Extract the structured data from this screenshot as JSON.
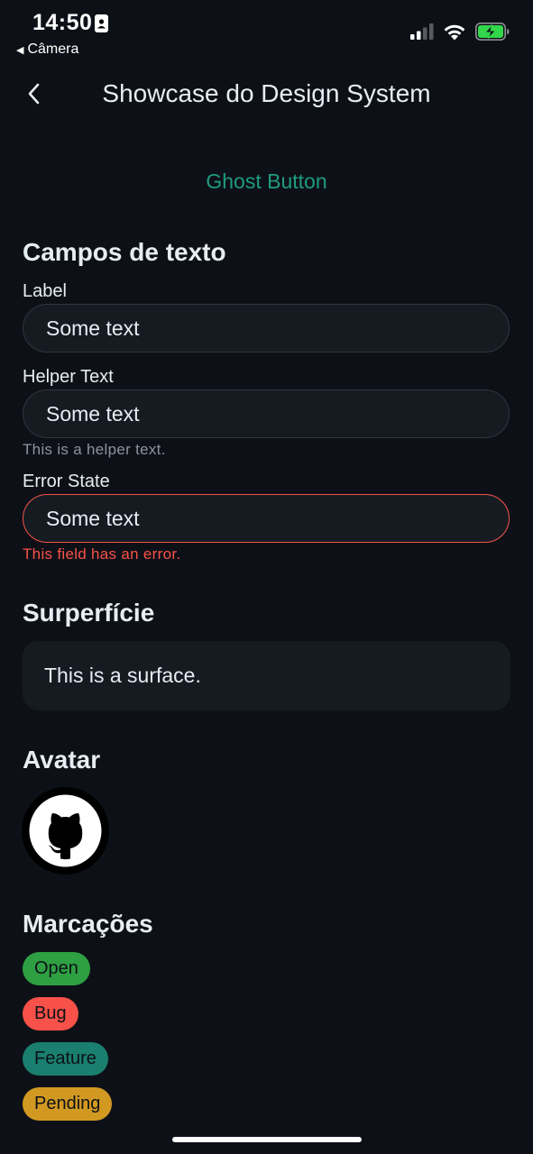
{
  "status_bar": {
    "time": "14:50",
    "back_app": "Câmera",
    "icons": [
      "contact-card-icon",
      "cellular-signal-icon",
      "wifi-icon",
      "battery-charging-icon"
    ],
    "battery_color": "#32d74b"
  },
  "nav": {
    "title": "Showcase do Design System",
    "back_icon": "chevron-left-icon"
  },
  "ghost_button": {
    "label": "Ghost Button",
    "color": "#1f9b7e"
  },
  "text_fields_section": {
    "title": "Campos de texto",
    "fields": [
      {
        "label": "Label",
        "value": "Some text"
      },
      {
        "label": "Helper Text",
        "value": "Some text",
        "helper": "This is a helper text."
      },
      {
        "label": "Error State",
        "value": "Some text",
        "error": "This field has an error.",
        "error_color": "#f85149"
      }
    ]
  },
  "surface_section": {
    "title": "Surperfície",
    "surface_text": "This is a surface."
  },
  "avatar_section": {
    "title": "Avatar",
    "avatar_icon": "github-octocat-icon"
  },
  "tags_section": {
    "title": "Marcações",
    "tags": [
      {
        "label": "Open",
        "color": "#2ea043"
      },
      {
        "label": "Bug",
        "color": "#f85149"
      },
      {
        "label": "Feature",
        "color": "#1a7f6e"
      },
      {
        "label": "Pending",
        "color": "#d29922"
      }
    ]
  }
}
